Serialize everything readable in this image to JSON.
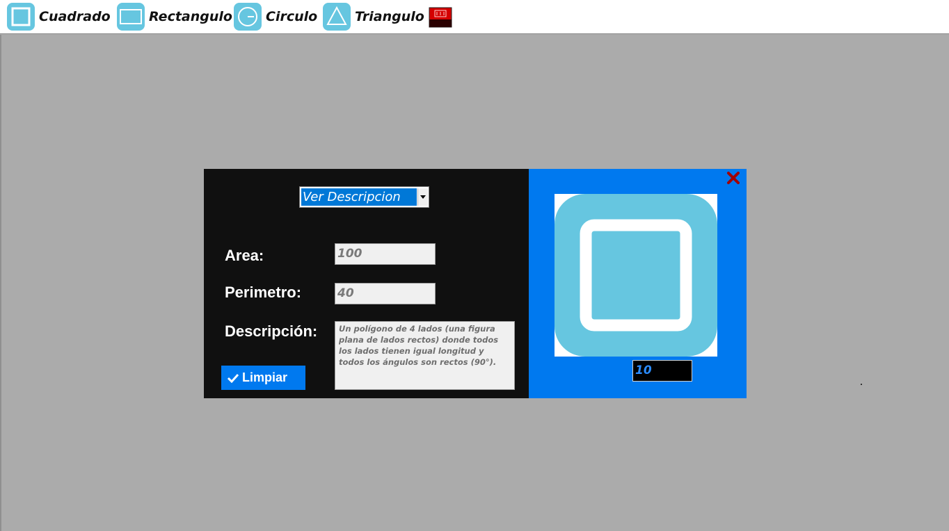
{
  "toolbar": {
    "items": [
      {
        "label": "Cuadrado",
        "icon": "square-icon"
      },
      {
        "label": "Rectangulo",
        "icon": "rectangle-icon"
      },
      {
        "label": "Circulo",
        "icon": "circle-icon"
      },
      {
        "label": "Triangulo",
        "icon": "triangle-icon"
      }
    ],
    "exit_icon": "exit-icon"
  },
  "dialog": {
    "dropdown": {
      "selected": "Ver Descripcion"
    },
    "area": {
      "label": "Area:",
      "value": "100"
    },
    "perimeter": {
      "label": "Perimetro:",
      "value": "40"
    },
    "description": {
      "label": "Descripción:",
      "text": "Un polígono de 4 lados (una figura plana de lados rectos) donde todos los lados tienen igual longitud y todos los ángulos son rectos (90°)."
    },
    "clear_button": {
      "label": "Limpiar"
    },
    "preview": {
      "icon": "square-shape-icon",
      "side_value": "10"
    }
  },
  "colors": {
    "accent_blue": "#0079ef",
    "shape_blue": "#66c6e0",
    "dialog_dark": "#101010",
    "desktop_gray": "#ababab",
    "close_red": "#a00000"
  }
}
